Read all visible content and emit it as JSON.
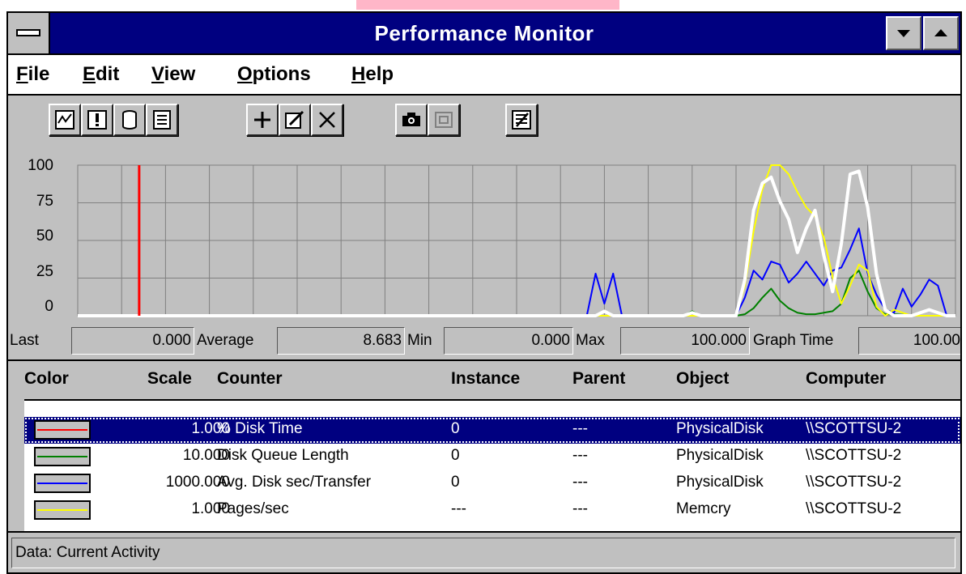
{
  "window": {
    "title": "Performance Monitor"
  },
  "menu": [
    {
      "label": "File",
      "key": "F",
      "rest": "ile"
    },
    {
      "label": "Edit",
      "key": "E",
      "rest": "dit"
    },
    {
      "label": "View",
      "key": "V",
      "rest": "iew"
    },
    {
      "label": "Options",
      "key": "O",
      "rest": "ptions"
    },
    {
      "label": "Help",
      "key": "H",
      "rest": "elp"
    }
  ],
  "toolbar": [
    {
      "name": "chart-view-icon"
    },
    {
      "name": "alert-view-icon"
    },
    {
      "name": "log-view-icon"
    },
    {
      "name": "report-view-icon"
    },
    {
      "name": "add-counter-icon"
    },
    {
      "name": "edit-counter-icon"
    },
    {
      "name": "delete-counter-icon"
    },
    {
      "name": "snapshot-camera-icon"
    },
    {
      "name": "export-icon"
    },
    {
      "name": "options-icon"
    }
  ],
  "chart_data": {
    "type": "line",
    "ylim": [
      0,
      100
    ],
    "y_ticks": [
      "100",
      "75",
      "50",
      "25",
      "0"
    ],
    "grid": true,
    "time_marker_x": 7,
    "x_range": [
      0,
      100
    ],
    "series": [
      {
        "color": "#008000",
        "points": [
          [
            0,
            0
          ],
          [
            69,
            0
          ],
          [
            70,
            3
          ],
          [
            71,
            0
          ],
          [
            75,
            0
          ],
          [
            76,
            1
          ],
          [
            77,
            5
          ],
          [
            78,
            12
          ],
          [
            79,
            18
          ],
          [
            80,
            10
          ],
          [
            81,
            5
          ],
          [
            82,
            2
          ],
          [
            83,
            1
          ],
          [
            84,
            1
          ],
          [
            85,
            2
          ],
          [
            86,
            3
          ],
          [
            87,
            8
          ],
          [
            88,
            25
          ],
          [
            89,
            30
          ],
          [
            90,
            16
          ],
          [
            91,
            5
          ],
          [
            92,
            1
          ],
          [
            93,
            1
          ],
          [
            96,
            0
          ],
          [
            100,
            0
          ]
        ]
      },
      {
        "color": "#0000ff",
        "points": [
          [
            0,
            0
          ],
          [
            58,
            0
          ],
          [
            59,
            28
          ],
          [
            60,
            8
          ],
          [
            61,
            28
          ],
          [
            62,
            0
          ],
          [
            69,
            0
          ],
          [
            70,
            2
          ],
          [
            71,
            0
          ],
          [
            75,
            0
          ],
          [
            76,
            12
          ],
          [
            77,
            30
          ],
          [
            78,
            24
          ],
          [
            79,
            36
          ],
          [
            80,
            34
          ],
          [
            81,
            22
          ],
          [
            82,
            28
          ],
          [
            83,
            36
          ],
          [
            84,
            28
          ],
          [
            85,
            20
          ],
          [
            86,
            30
          ],
          [
            87,
            32
          ],
          [
            88,
            44
          ],
          [
            89,
            58
          ],
          [
            90,
            28
          ],
          [
            91,
            14
          ],
          [
            92,
            4
          ],
          [
            93,
            2
          ],
          [
            94,
            18
          ],
          [
            95,
            6
          ],
          [
            96,
            14
          ],
          [
            97,
            24
          ],
          [
            98,
            20
          ],
          [
            99,
            0
          ],
          [
            100,
            0
          ]
        ]
      },
      {
        "color": "#ffff00",
        "points": [
          [
            0,
            0
          ],
          [
            75,
            0
          ],
          [
            76,
            20
          ],
          [
            77,
            56
          ],
          [
            78,
            84
          ],
          [
            79,
            100
          ],
          [
            80,
            100
          ],
          [
            81,
            94
          ],
          [
            82,
            82
          ],
          [
            83,
            72
          ],
          [
            84,
            66
          ],
          [
            85,
            52
          ],
          [
            86,
            26
          ],
          [
            87,
            8
          ],
          [
            88,
            20
          ],
          [
            89,
            34
          ],
          [
            90,
            30
          ],
          [
            91,
            6
          ],
          [
            92,
            0
          ],
          [
            93,
            4
          ],
          [
            94,
            2
          ],
          [
            95,
            0
          ],
          [
            100,
            0
          ]
        ]
      },
      {
        "color": "#ffffff",
        "width": 4,
        "points": [
          [
            0,
            0
          ],
          [
            59,
            0
          ],
          [
            60,
            3
          ],
          [
            61,
            0
          ],
          [
            69,
            0
          ],
          [
            70,
            2
          ],
          [
            71,
            0
          ],
          [
            75,
            0
          ],
          [
            76,
            24
          ],
          [
            77,
            70
          ],
          [
            78,
            88
          ],
          [
            79,
            92
          ],
          [
            80,
            76
          ],
          [
            81,
            64
          ],
          [
            82,
            42
          ],
          [
            83,
            58
          ],
          [
            84,
            70
          ],
          [
            85,
            40
          ],
          [
            86,
            16
          ],
          [
            87,
            48
          ],
          [
            88,
            94
          ],
          [
            89,
            96
          ],
          [
            90,
            72
          ],
          [
            91,
            28
          ],
          [
            92,
            4
          ],
          [
            93,
            0
          ],
          [
            95,
            0
          ],
          [
            96,
            2
          ],
          [
            97,
            4
          ],
          [
            98,
            2
          ],
          [
            99,
            0
          ],
          [
            100,
            0
          ]
        ]
      }
    ]
  },
  "values": {
    "last_label": "Last",
    "last": "0.000",
    "average_label": "Average",
    "average": "8.683",
    "min_label": "Min",
    "min": "0.000",
    "max_label": "Max",
    "max": "100.000",
    "graph_time_label": "Graph Time",
    "graph_time": "100.00"
  },
  "legend": {
    "headers": {
      "color": "Color",
      "scale": "Scale",
      "counter": "Counter",
      "instance": "Instance",
      "parent": "Parent",
      "object": "Object",
      "computer": "Computer"
    },
    "rows": [
      {
        "color": "#ff0000",
        "scale": "1.000",
        "counter": "% Disk Time",
        "instance": "0",
        "parent": "---",
        "object": "PhysicalDisk",
        "computer": "\\\\SCOTTSU-2"
      },
      {
        "color": "#008000",
        "scale": "10.000",
        "counter": "Disk Queue Length",
        "instance": "0",
        "parent": "---",
        "object": "PhysicalDisk",
        "computer": "\\\\SCOTTSU-2"
      },
      {
        "color": "#0000ff",
        "scale": "1000.000",
        "counter": "Avg. Disk sec/Transfer",
        "instance": "0",
        "parent": "---",
        "object": "PhysicalDisk",
        "computer": "\\\\SCOTTSU-2"
      },
      {
        "color": "#ffff00",
        "scale": "1.000",
        "counter": "Pages/sec",
        "instance": "---",
        "parent": "---",
        "object": "Memcry",
        "computer": "\\\\SCOTTSU-2"
      }
    ]
  },
  "status": {
    "text": "Data: Current Activity"
  }
}
